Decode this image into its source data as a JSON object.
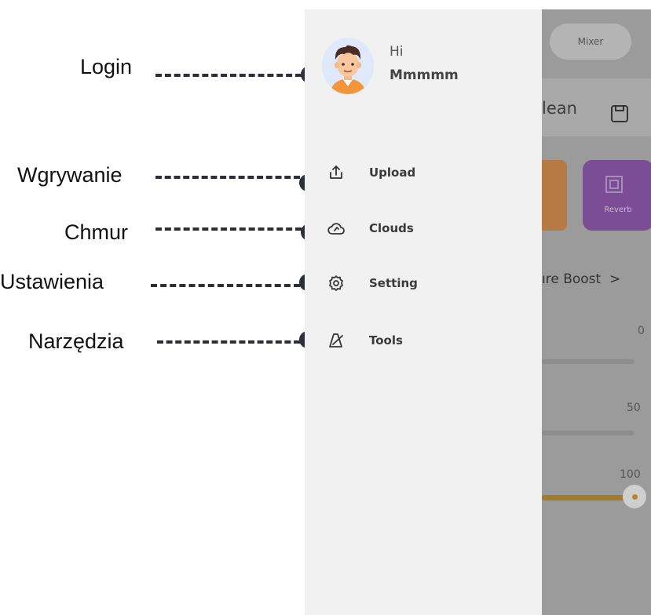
{
  "callouts": [
    {
      "id": "login",
      "label": "Login"
    },
    {
      "id": "upload",
      "label": "Wgrywanie"
    },
    {
      "id": "clouds",
      "label": "Chmur"
    },
    {
      "id": "setting",
      "label": "Ustawienia"
    },
    {
      "id": "tools",
      "label": "Narzędzia"
    }
  ],
  "drawer": {
    "greeting": "Hi",
    "username": "Mmmmm",
    "items": [
      {
        "label": "Upload",
        "icon": "upload-icon"
      },
      {
        "label": "Clouds",
        "icon": "cloud-icon"
      },
      {
        "label": "Setting",
        "icon": "gear-icon"
      },
      {
        "label": "Tools",
        "icon": "metronome-icon"
      }
    ]
  },
  "background_app": {
    "mixer_label": "Mixer",
    "preset_text": "lean",
    "reverb_label": "Reverb",
    "boost_text": "ıre Boost",
    "slider_values": [
      "0",
      "50",
      "100"
    ]
  },
  "colors": {
    "drawer_bg": "#f1f1f1",
    "overlay": "#9b9b9b",
    "reverb_card": "#7a4d95",
    "slider_accent": "#a27a2c"
  }
}
